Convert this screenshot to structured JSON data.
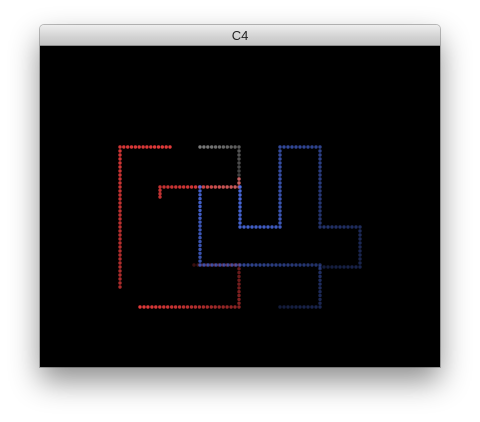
{
  "window": {
    "title": "C4"
  },
  "colors": {
    "background": "#000000",
    "red_trail": "#e23a3a",
    "blue_trail": "#4c6ee8",
    "gray_trail": "#9a9a9a"
  }
}
